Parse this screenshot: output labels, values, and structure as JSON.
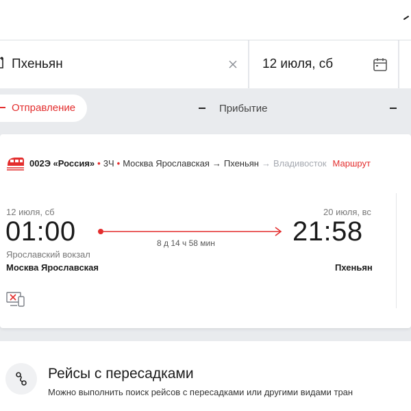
{
  "search": {
    "destination": "Пхеньян",
    "date": "12 июля, сб"
  },
  "sort": {
    "departure_label": "Отправление",
    "arrival_label": "Прибытие"
  },
  "train": {
    "number": "002Э «Россия»",
    "duration_class": "3Ч",
    "from": "Москва Ярославская",
    "to": "Пхеньян",
    "final": "Владивосток",
    "route_link": "Маршрут",
    "departure_date": "12 июля, сб",
    "departure_time": "01:00",
    "arrival_date": "20 июля, вс",
    "arrival_time": "21:58",
    "travel_time": "8 д 14 ч 58 мин",
    "departure_station_small": "Ярославский вокзал",
    "departure_station": "Москва Ярославская",
    "arrival_station": "Пхеньян"
  },
  "transfers": {
    "title": "Рейсы с пересадками",
    "subtitle": "Можно выполнить поиск рейсов с пересадками или другими видами тран"
  },
  "colors": {
    "accent": "#e32d2d",
    "background": "#e9ebee",
    "card": "#ffffff"
  },
  "icons": {
    "swap": "swap-icon",
    "clear": "close-icon",
    "calendar": "calendar-icon",
    "train": "train-icon",
    "no_eticket": "no-eticket-icon",
    "transfer": "transfer-icon"
  }
}
